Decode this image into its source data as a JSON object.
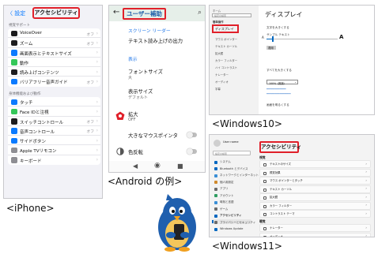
{
  "iphone": {
    "caption": "<iPhone>",
    "back_label": "〈 設定",
    "title": "アクセシビリティ",
    "section1": "視覚サポート",
    "section2": "身体機能および動作",
    "group1": [
      {
        "label": "VoiceOver",
        "value": "オフ",
        "icon_color": "#1c1c1e"
      },
      {
        "label": "ズーム",
        "value": "オフ",
        "icon_color": "#1c1c1e"
      },
      {
        "label": "画面表示とテキストサイズ",
        "value": "",
        "icon_color": "#0a7aff"
      },
      {
        "label": "動作",
        "value": "",
        "icon_color": "#34c759"
      },
      {
        "label": "読み上げコンテンツ",
        "value": "",
        "icon_color": "#1c1c1e"
      },
      {
        "label": "バリアフリー音声ガイド",
        "value": "オフ",
        "icon_color": "#0a7aff"
      }
    ],
    "group2": [
      {
        "label": "タッチ",
        "value": "",
        "icon_color": "#0a7aff"
      },
      {
        "label": "Face IDと注視",
        "value": "",
        "icon_color": "#34c759"
      },
      {
        "label": "スイッチコントロール",
        "value": "オフ",
        "icon_color": "#1c1c1e"
      },
      {
        "label": "音声コントロール",
        "value": "オフ",
        "icon_color": "#0a7aff"
      },
      {
        "label": "サイドボタン",
        "value": "",
        "icon_color": "#0a7aff"
      },
      {
        "label": "Apple TVリモコン",
        "value": "",
        "icon_color": "#8e8e93"
      },
      {
        "label": "キーボード",
        "value": "",
        "icon_color": "#8e8e93"
      }
    ]
  },
  "android": {
    "caption": "<Android の例>",
    "title": "ユーザー補助",
    "screen_reader_section": "スクリーン リーダー",
    "tts_output": "テキスト読み上げの出力",
    "display_section": "表示",
    "font_size": "フォントサイズ",
    "font_size_value": "大",
    "display_size": "表示サイズ",
    "display_size_value": "デフォルト",
    "magnify": "拡大",
    "magnify_value": "OFF",
    "large_pointer": "大きなマウスポインタ",
    "color_inversion": "色反転",
    "accent_color": "#e0202a"
  },
  "win10": {
    "caption": "<Windows10>",
    "sidebar_top": "ホーム",
    "sidebar_search": "設定の検索",
    "sidebar_group": "簡単操作",
    "sidebar_selected": "ディスプレイ",
    "sidebar_items": [
      "マウス ポインター",
      "テキスト カーソル",
      "拡大鏡",
      "カラー フィルター",
      "ハイ コントラスト",
      "ナレーター",
      "オーディオ",
      "字幕"
    ],
    "heading": "ディスプレイ",
    "text_size_title": "文字を大きくする",
    "sample_text": "サンプル テキスト",
    "apply_button": "適用",
    "enlarge_title": "すべてを大きくする",
    "scale_value": "100%（推奨）",
    "brightness_title": "画面を明るくする"
  },
  "win11": {
    "caption": "<Windows11>",
    "user_name": "User name",
    "search_placeholder": "設定の検索",
    "title": "アクセシビリティ",
    "sidebar_items": [
      "システム",
      "Bluetooth とデバイス",
      "ネットワークとインターネット",
      "個人用設定",
      "アプリ",
      "アカウント",
      "時刻と言語",
      "ゲーム",
      "アクセシビリティ",
      "プライバシーとセキュリティ",
      "Windows Update"
    ],
    "selected_index": 8,
    "group_vision": "視覚",
    "group_hearing": "聴覚",
    "cards": [
      {
        "label": "テキストのサイズ",
        "sub": ""
      },
      {
        "label": "視覚効果",
        "sub": ""
      },
      {
        "label": "マウス ポインターとタッチ",
        "sub": ""
      },
      {
        "label": "テキスト カーソル",
        "sub": ""
      },
      {
        "label": "拡大鏡",
        "sub": ""
      },
      {
        "label": "カラー フィルター",
        "sub": ""
      },
      {
        "label": "コントラスト テーマ",
        "sub": ""
      },
      {
        "label": "ナレーター",
        "sub": ""
      },
      {
        "label": "オーディオ",
        "sub": ""
      },
      {
        "label": "字幕",
        "sub": ""
      }
    ]
  },
  "mascot": {
    "body_color": "#1f5fae",
    "belly_color": "#f3c65b",
    "phone_color": "#222222"
  }
}
